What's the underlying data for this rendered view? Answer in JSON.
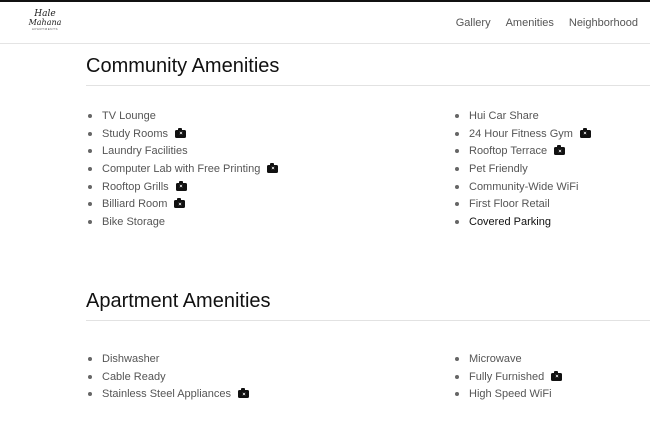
{
  "header": {
    "logo": {
      "line1": "Hale",
      "line2": "Mahana",
      "line3": "APARTMENTS"
    },
    "nav": [
      "Gallery",
      "Amenities",
      "Neighborhood"
    ]
  },
  "community": {
    "title": "Community Amenities",
    "left": [
      {
        "label": "TV Lounge",
        "photo": false
      },
      {
        "label": "Study Rooms",
        "photo": true
      },
      {
        "label": "Laundry Facilities",
        "photo": false
      },
      {
        "label": "Computer Lab with Free Printing",
        "photo": true
      },
      {
        "label": "Rooftop Grills",
        "photo": true
      },
      {
        "label": "Billiard Room",
        "photo": true
      },
      {
        "label": "Bike Storage",
        "photo": false
      }
    ],
    "right": [
      {
        "label": "Hui Car Share",
        "photo": false
      },
      {
        "label": "24 Hour Fitness Gym",
        "photo": true
      },
      {
        "label": "Rooftop Terrace",
        "photo": true
      },
      {
        "label": "Pet Friendly",
        "photo": false
      },
      {
        "label": "Community-Wide WiFi",
        "photo": false
      },
      {
        "label": "First Floor Retail",
        "photo": false
      },
      {
        "label": "Covered Parking",
        "photo": false
      }
    ]
  },
  "apartment": {
    "title": "Apartment Amenities",
    "left": [
      {
        "label": "Dishwasher",
        "photo": false
      },
      {
        "label": "Cable Ready",
        "photo": false
      },
      {
        "label": "Stainless Steel Appliances",
        "photo": true
      }
    ],
    "right": [
      {
        "label": "Microwave",
        "photo": false
      },
      {
        "label": "Fully Furnished",
        "photo": true
      },
      {
        "label": "High Speed WiFi",
        "photo": false
      }
    ]
  },
  "icons": {
    "photo": "camera-icon",
    "bullet": "bullet-dot"
  },
  "colors": {
    "text": "#555555",
    "heading": "#111111",
    "rule": "#e2e2e2",
    "topbar": "#111111"
  }
}
